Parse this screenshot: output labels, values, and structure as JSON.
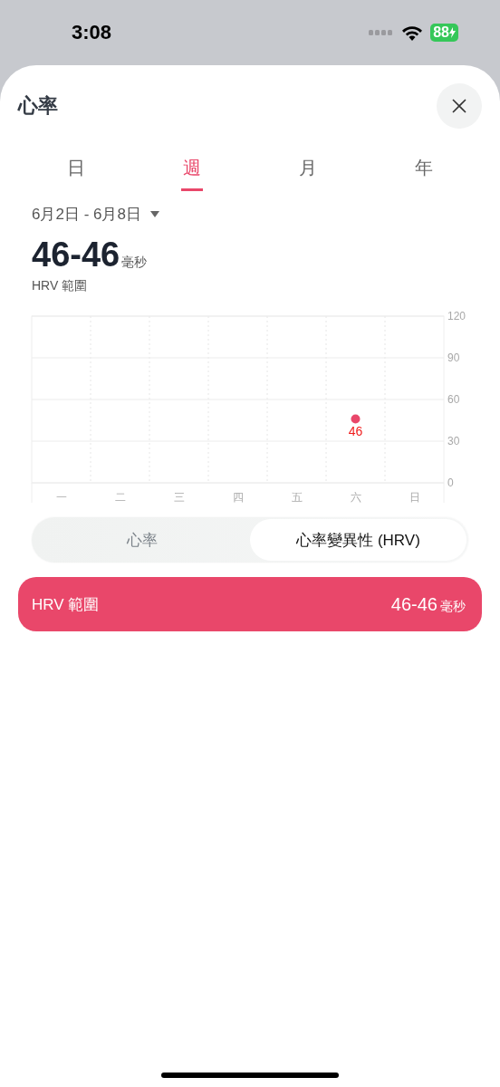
{
  "status_bar": {
    "time": "3:08",
    "battery": "88"
  },
  "header": {
    "title": "心率"
  },
  "tabs": [
    {
      "label": "日",
      "selected": false
    },
    {
      "label": "週",
      "selected": true
    },
    {
      "label": "月",
      "selected": false
    },
    {
      "label": "年",
      "selected": false
    }
  ],
  "date_range": "6月2日 - 6月8日",
  "summary": {
    "value": "46-46",
    "unit": "毫秒",
    "label": "HRV 範圍"
  },
  "chart_data": {
    "type": "scatter",
    "categories": [
      "一",
      "二",
      "三",
      "四",
      "五",
      "六",
      "日"
    ],
    "series": [
      {
        "color": "#e9476a",
        "values": [
          null,
          null,
          null,
          null,
          null,
          46,
          null
        ]
      }
    ],
    "ylim": [
      0,
      120
    ],
    "yticks": [
      0,
      30,
      60,
      90,
      120
    ],
    "data_labels": true,
    "grid": true
  },
  "segments": [
    {
      "label": "心率",
      "selected": false
    },
    {
      "label": "心率變異性 (HRV)",
      "selected": true
    }
  ],
  "range_card": {
    "label": "HRV 範圍",
    "value": "46-46",
    "unit": "毫秒"
  }
}
